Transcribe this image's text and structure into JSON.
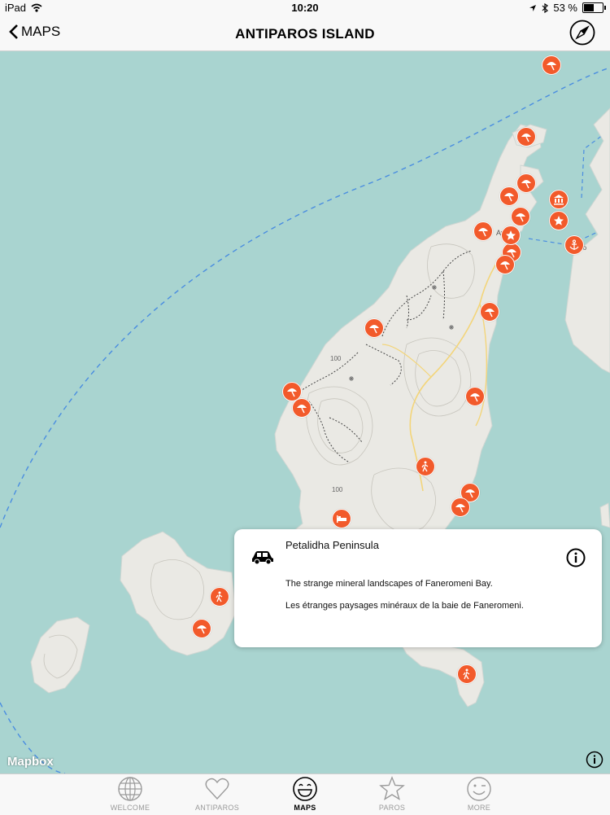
{
  "status": {
    "device": "iPad",
    "time": "10:20",
    "battery": "53 %",
    "battery_level": 0.53
  },
  "nav": {
    "back_label": "MAPS",
    "title": "ANTIPAROS ISLAND",
    "compass_icon": "compass-icon"
  },
  "map": {
    "attribution": "Mapbox",
    "water_color": "#a9d4d0",
    "land_color": "#eaeae6",
    "marker_color": "#f25a2b",
    "place_labels": [
      "Av",
      "ro"
    ],
    "elevation_labels": [
      "100",
      "100"
    ],
    "markers": [
      "beach",
      "beach",
      "beach",
      "beach",
      "beach",
      "museum",
      "star",
      "beach",
      "beach",
      "star",
      "anchor",
      "beach",
      "beach",
      "beach",
      "beach",
      "beach",
      "beach",
      "beach",
      "hiking",
      "beach",
      "beach",
      "bed",
      "hiking",
      "beach",
      "hiking"
    ]
  },
  "popup": {
    "title": "Petalidha Peninsula",
    "desc_en": "The strange mineral landscapes of Faneromeni Bay.",
    "desc_fr": "Les étranges paysages minéraux de la baie de Faneromeni.",
    "category_icon": "car-icon"
  },
  "tabs": [
    {
      "label": "WELCOME",
      "icon": "globe-icon",
      "active": false
    },
    {
      "label": "ANTIPAROS",
      "icon": "heart-icon",
      "active": false
    },
    {
      "label": "MAPS",
      "icon": "smiley-icon",
      "active": true
    },
    {
      "label": "PAROS",
      "icon": "star-icon",
      "active": false
    },
    {
      "label": "MORE",
      "icon": "wink-icon",
      "active": false
    }
  ]
}
